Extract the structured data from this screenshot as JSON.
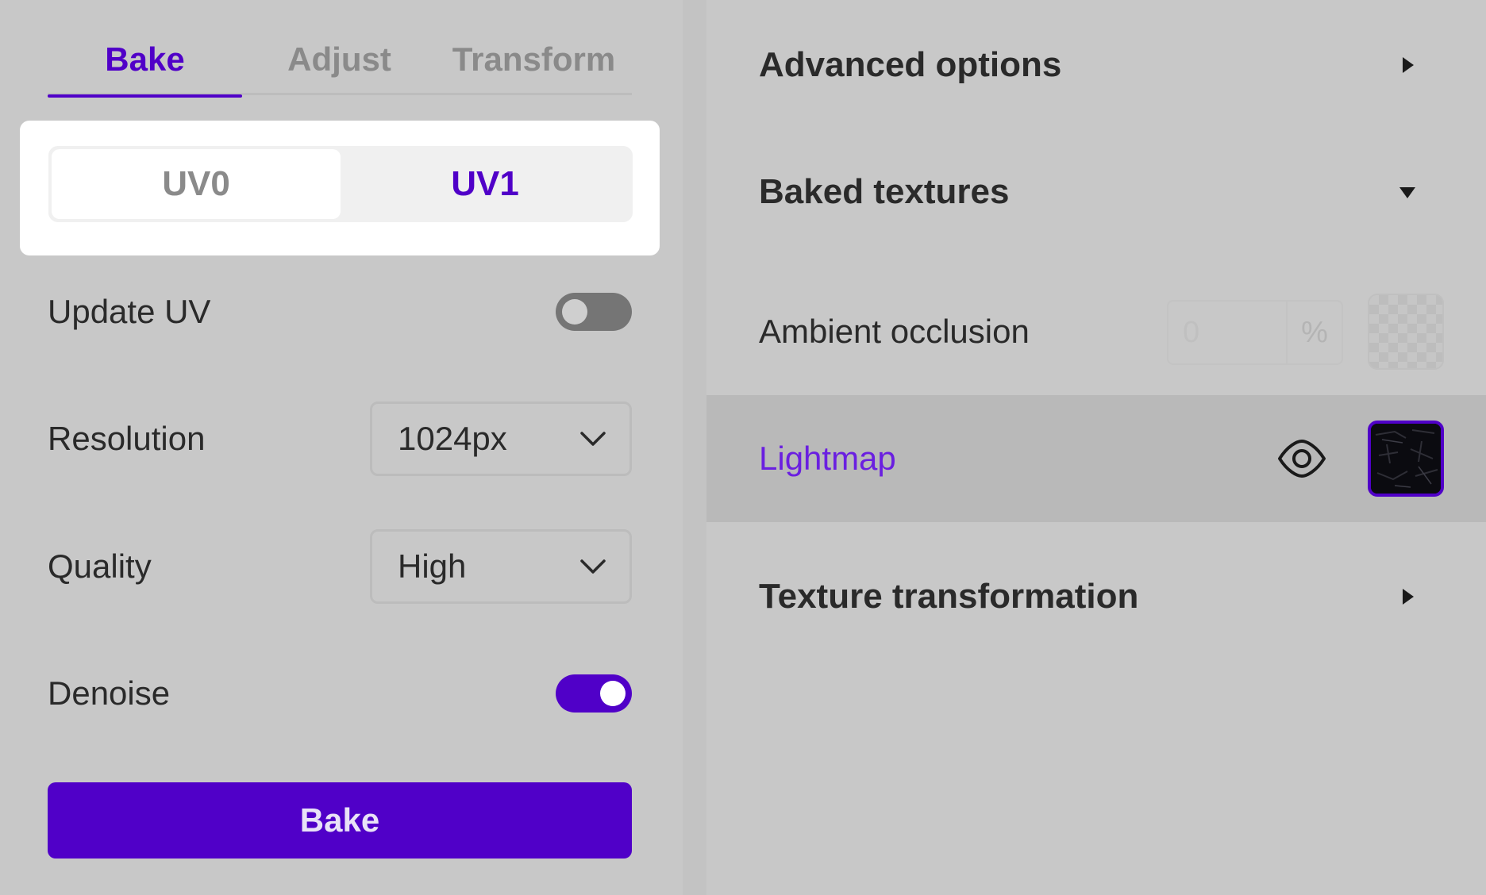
{
  "left_panel": {
    "tabs": [
      {
        "label": "Bake",
        "active": true
      },
      {
        "label": "Adjust",
        "active": false
      },
      {
        "label": "Transform",
        "active": false
      }
    ],
    "uv_selector": {
      "options": [
        "UV0",
        "UV1"
      ],
      "selected": "UV1"
    },
    "update_uv": {
      "label": "Update UV",
      "enabled": false
    },
    "resolution": {
      "label": "Resolution",
      "value": "1024px"
    },
    "quality": {
      "label": "Quality",
      "value": "High"
    },
    "denoise": {
      "label": "Denoise",
      "enabled": true
    },
    "bake_button": {
      "label": "Bake"
    }
  },
  "right_panel": {
    "advanced_options": {
      "title": "Advanced options",
      "expanded": false,
      "icon": "triangle-right-icon"
    },
    "baked_textures": {
      "title": "Baked textures",
      "expanded": true,
      "icon": "triangle-down-icon",
      "items": [
        {
          "label": "Ambient occlusion",
          "value": "0",
          "unit": "%",
          "thumbnail": "checkerboard"
        },
        {
          "label": "Lightmap",
          "selected": true,
          "visibility_icon": "eye-icon",
          "thumbnail": "dark-lightmap"
        }
      ]
    },
    "texture_transformation": {
      "title": "Texture transformation",
      "expanded": false,
      "icon": "triangle-right-icon"
    }
  },
  "colors": {
    "accent": "#5000c8",
    "panel_bg": "#c8c8c8",
    "selected_row_bg": "#b9b9b9"
  }
}
